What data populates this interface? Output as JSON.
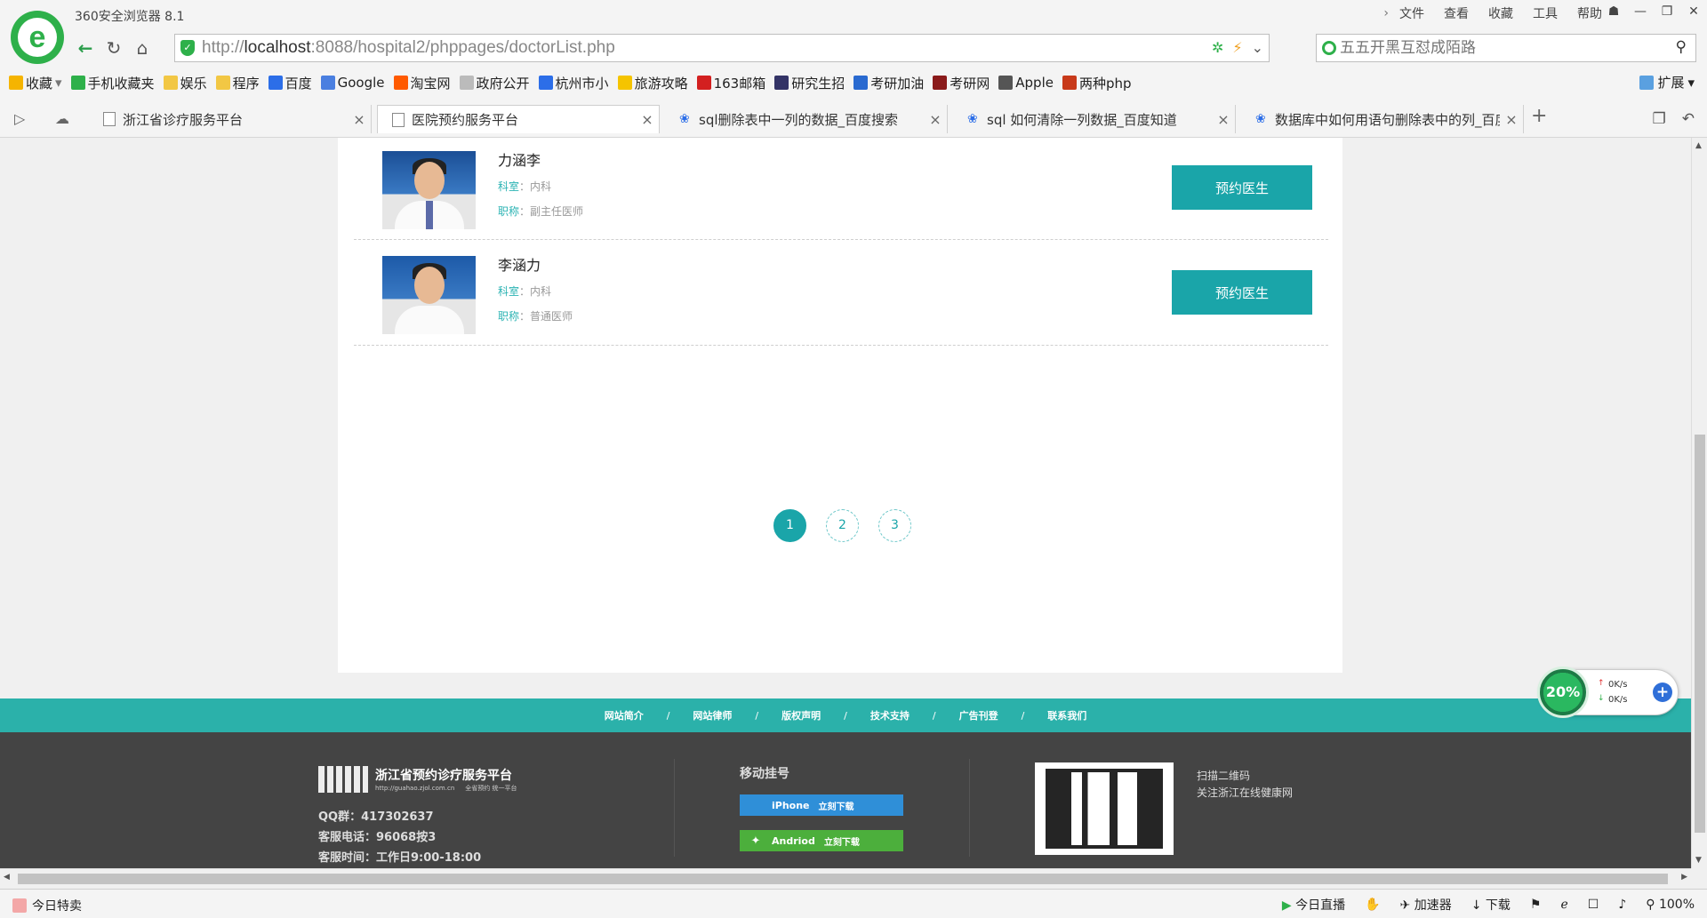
{
  "browser": {
    "app_title": "360安全浏览器 8.1",
    "menu": [
      "文件",
      "查看",
      "收藏",
      "工具",
      "帮助"
    ],
    "url_host": "localhost",
    "url_prefix": "http://",
    "url_rest": ":8088/hospital2/phppages/doctorList.php",
    "search_placeholder": "五五开黑互怼成陌路",
    "bookmarks": [
      {
        "label": "收藏",
        "color": "#f5b400"
      },
      {
        "label": "手机收藏夹",
        "color": "#2eb04a"
      },
      {
        "label": "娱乐",
        "color": "#f2c744"
      },
      {
        "label": "程序",
        "color": "#f2c744"
      },
      {
        "label": "百度",
        "color": "#2c6ee8"
      },
      {
        "label": "Google",
        "color": "#4a7fe0"
      },
      {
        "label": "淘宝网",
        "color": "#ff5a00"
      },
      {
        "label": "政府公开",
        "color": "#bbbbbb"
      },
      {
        "label": "杭州市小",
        "color": "#2c6ee8"
      },
      {
        "label": "旅游攻略",
        "color": "#f5c400"
      },
      {
        "label": "163邮箱",
        "color": "#d32020"
      },
      {
        "label": "研究生招",
        "color": "#333366"
      },
      {
        "label": "考研加油",
        "color": "#2a6ad0"
      },
      {
        "label": "考研网",
        "color": "#8a1a1a"
      },
      {
        "label": "Apple",
        "color": "#555555"
      },
      {
        "label": "两种php",
        "color": "#c83a1a"
      }
    ],
    "extensions_label": "扩展",
    "tabs": [
      {
        "label": "浙江省诊疗服务平台",
        "icon": "page-icon"
      },
      {
        "label": "医院预约服务平台",
        "icon": "page-icon"
      },
      {
        "label": "sql删除表中一列的数据_百度搜索",
        "icon": "baidu-paw-icon"
      },
      {
        "label": "sql 如何清除一列数据_百度知道",
        "icon": "baidu-paw-icon"
      },
      {
        "label": "数据库中如何用语句删除表中的列_百度",
        "icon": "baidu-paw-icon"
      }
    ]
  },
  "doctors": [
    {
      "name": "力涵李",
      "dept_key": "科室",
      "dept": "内科",
      "title_key": "职称",
      "title": "副主任医师",
      "button": "预约医生"
    },
    {
      "name": "李涵力",
      "dept_key": "科室",
      "dept": "内科",
      "title_key": "职称",
      "title": "普通医师",
      "button": "预约医生"
    }
  ],
  "separator": "：",
  "pagination": {
    "pages": [
      "1",
      "2",
      "3"
    ],
    "current": 1
  },
  "footer": {
    "nav": [
      "网站简介",
      "网站律师",
      "版权声明",
      "技术支持",
      "广告刊登",
      "联系我们"
    ],
    "nav_sep": "/",
    "site_title": "浙江省预约诊疗服务平台",
    "site_url": "http://guahao.zjol.com.cn",
    "slogan": "全省预约 统一平台",
    "qq": "QQ群：417302637",
    "phone": "客服电话：96068按3",
    "hours": "客服时间：工作日9:00-18:00",
    "mobile_title": "移动挂号",
    "iphone_label": "iPhone",
    "android_label": "Andriod",
    "download_label": "立刻下载",
    "qr_line1": "扫描二维码",
    "qr_line2": "关注浙江在线健康网",
    "iphone_color": "#2f8fd8",
    "android_color": "#4caf3c"
  },
  "speed_widget": {
    "percent": "20%",
    "up": "0K/s",
    "down": "0K/s"
  },
  "status_bar": {
    "left": "今日特卖",
    "live": "今日直播",
    "accelerator": "加速器",
    "download": "下载",
    "zoom": "100%"
  }
}
